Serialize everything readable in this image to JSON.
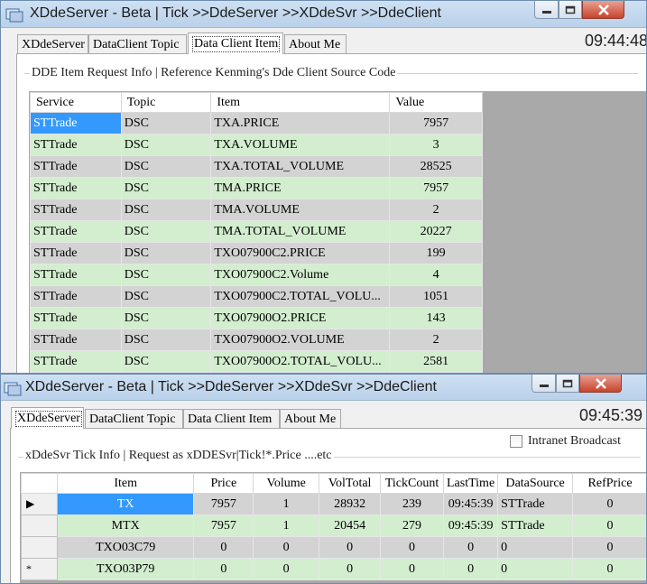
{
  "window1": {
    "title": "XDdeServer - Beta | Tick >>DdeServer >>XDdeSvr >>DdeClient",
    "clock": "09:44:48",
    "tabs": [
      {
        "label": "XDdeServer"
      },
      {
        "label": "DataClient Topic"
      },
      {
        "label": "Data Client Item"
      },
      {
        "label": "About Me"
      }
    ],
    "active_tab": "Data Client Item",
    "group_title": "DDE Item Request Info |  Reference Kenming's Dde Client Source Code",
    "columns": [
      "Service",
      "Topic",
      "Item",
      "Value"
    ],
    "rows": [
      {
        "service": "STTrade",
        "topic": "DSC",
        "item": "TXA.PRICE",
        "value": "7957"
      },
      {
        "service": "STTrade",
        "topic": "DSC",
        "item": "TXA.VOLUME",
        "value": "3"
      },
      {
        "service": "STTrade",
        "topic": "DSC",
        "item": "TXA.TOTAL_VOLUME",
        "value": "28525"
      },
      {
        "service": "STTrade",
        "topic": "DSC",
        "item": "TMA.PRICE",
        "value": "7957"
      },
      {
        "service": "STTrade",
        "topic": "DSC",
        "item": "TMA.VOLUME",
        "value": "2"
      },
      {
        "service": "STTrade",
        "topic": "DSC",
        "item": "TMA.TOTAL_VOLUME",
        "value": "20227"
      },
      {
        "service": "STTrade",
        "topic": "DSC",
        "item": "TXO07900C2.PRICE",
        "value": "199"
      },
      {
        "service": "STTrade",
        "topic": "DSC",
        "item": "TXO07900C2.Volume",
        "value": "4"
      },
      {
        "service": "STTrade",
        "topic": "DSC",
        "item": "TXO07900C2.TOTAL_VOLU...",
        "value": "1051"
      },
      {
        "service": "STTrade",
        "topic": "DSC",
        "item": "TXO07900O2.PRICE",
        "value": "143"
      },
      {
        "service": "STTrade",
        "topic": "DSC",
        "item": "TXO07900O2.VOLUME",
        "value": "2"
      },
      {
        "service": "STTrade",
        "topic": "DSC",
        "item": "TXO07900O2.TOTAL_VOLU...",
        "value": "2581"
      }
    ]
  },
  "window2": {
    "title": "XDdeServer - Beta | Tick >>DdeServer >>XDdeSvr >>DdeClient",
    "clock": "09:45:39",
    "tabs": [
      {
        "label": "XDdeServer"
      },
      {
        "label": "DataClient Topic"
      },
      {
        "label": "Data Client Item"
      },
      {
        "label": "About Me"
      }
    ],
    "active_tab": "XDdeServer",
    "group_title": "xDdeSvr Tick Info |  Request as xDDESvr|Tick!*.Price ....etc",
    "checkbox_label": "Intranet Broadcast",
    "checkbox_checked": false,
    "columns": [
      "Item",
      "Price",
      "Volume",
      "VolTotal",
      "TickCount",
      "LastTime",
      "DataSource",
      "RefPrice"
    ],
    "row_markers": [
      "▶",
      "",
      "",
      "*"
    ],
    "rows": [
      {
        "item": "TX",
        "price": "7957",
        "volume": "1",
        "voltotal": "28932",
        "tickcount": "239",
        "lasttime": "09:45:39",
        "datasource": "STTrade",
        "refprice": "0"
      },
      {
        "item": "MTX",
        "price": "7957",
        "volume": "1",
        "voltotal": "20454",
        "tickcount": "279",
        "lasttime": "09:45:39",
        "datasource": "STTrade",
        "refprice": "0"
      },
      {
        "item": "TXO03C79",
        "price": "0",
        "volume": "0",
        "voltotal": "0",
        "tickcount": "0",
        "lasttime": "0",
        "datasource": "0",
        "refprice": "0"
      },
      {
        "item": "TXO03P79",
        "price": "0",
        "volume": "0",
        "voltotal": "0",
        "tickcount": "0",
        "lasttime": "0",
        "datasource": "0",
        "refprice": "0"
      }
    ]
  },
  "icons": {
    "app": "app-icon",
    "minimize": "minimize-icon",
    "maximize": "maximize-icon",
    "close": "close-icon"
  },
  "colors": {
    "row_gray": "#d3d3d3",
    "row_green": "#d3eecf",
    "selection": "#3399ff"
  }
}
